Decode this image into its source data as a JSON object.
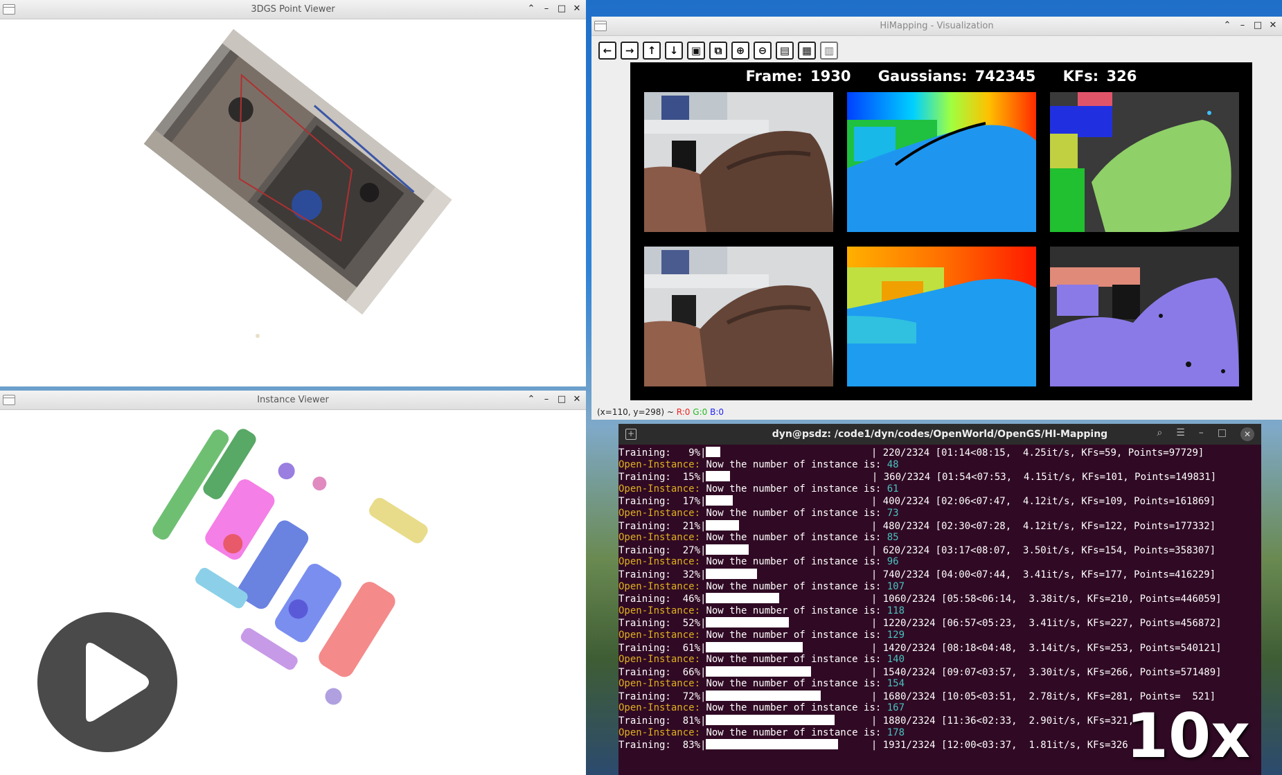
{
  "point_viewer": {
    "title": "3DGS Point Viewer"
  },
  "instance_viewer": {
    "title": "Instance Viewer"
  },
  "visualization": {
    "title": "HiMapping - Visualization",
    "toolbar": [
      "arrow-left-icon",
      "arrow-right-icon",
      "arrow-up-icon",
      "arrow-down-icon",
      "frame-icon",
      "export-icon",
      "zoom-in-icon",
      "zoom-out-icon",
      "save-icon",
      "clipboard-icon",
      "settings-icon"
    ],
    "stats": {
      "frame": "Frame: 1930",
      "gaussians": "Gaussians: 742345",
      "kfs": "KFs: 326"
    },
    "coord": {
      "prefix": "(x=110, y=298) ~ ",
      "r": "R:0",
      "g": "G:0",
      "b": "B:0"
    }
  },
  "terminal": {
    "title": "dyn@psdz: /code1/dyn/codes/OpenWorld/OpenGS/HI-Mapping",
    "oi_label": "Open-Instance:",
    "oi_text": " Now the number of instance is: ",
    "lines": [
      {
        "type": "train",
        "pct": "9%",
        "frac": 0.09,
        "text": "| 220/2324 [01:14<08:15,  4.25it/s, KFs=59, Points=97729]"
      },
      {
        "type": "oi",
        "n": "48"
      },
      {
        "type": "train",
        "pct": "15%",
        "frac": 0.15,
        "text": "| 360/2324 [01:54<07:53,  4.15it/s, KFs=101, Points=149831]"
      },
      {
        "type": "oi",
        "n": "61"
      },
      {
        "type": "train",
        "pct": "17%",
        "frac": 0.17,
        "text": "| 400/2324 [02:06<07:47,  4.12it/s, KFs=109, Points=161869]"
      },
      {
        "type": "oi",
        "n": "73"
      },
      {
        "type": "train",
        "pct": "21%",
        "frac": 0.21,
        "text": "| 480/2324 [02:30<07:28,  4.12it/s, KFs=122, Points=177332]"
      },
      {
        "type": "oi",
        "n": "85"
      },
      {
        "type": "train",
        "pct": "27%",
        "frac": 0.27,
        "text": "| 620/2324 [03:17<08:07,  3.50it/s, KFs=154, Points=358307]"
      },
      {
        "type": "oi",
        "n": "96"
      },
      {
        "type": "train",
        "pct": "32%",
        "frac": 0.32,
        "text": "| 740/2324 [04:00<07:44,  3.41it/s, KFs=177, Points=416229]"
      },
      {
        "type": "oi",
        "n": "107"
      },
      {
        "type": "train",
        "pct": "46%",
        "frac": 0.46,
        "text": "| 1060/2324 [05:58<06:14,  3.38it/s, KFs=210, Points=446059]"
      },
      {
        "type": "oi",
        "n": "118"
      },
      {
        "type": "train",
        "pct": "52%",
        "frac": 0.52,
        "text": "| 1220/2324 [06:57<05:23,  3.41it/s, KFs=227, Points=456872]"
      },
      {
        "type": "oi",
        "n": "129"
      },
      {
        "type": "train",
        "pct": "61%",
        "frac": 0.61,
        "text": "| 1420/2324 [08:18<04:48,  3.14it/s, KFs=253, Points=540121]"
      },
      {
        "type": "oi",
        "n": "140"
      },
      {
        "type": "train",
        "pct": "66%",
        "frac": 0.66,
        "text": "| 1540/2324 [09:07<03:57,  3.30it/s, KFs=266, Points=571489]"
      },
      {
        "type": "oi",
        "n": "154"
      },
      {
        "type": "train",
        "pct": "72%",
        "frac": 0.72,
        "text": "| 1680/2324 [10:05<03:51,  2.78it/s, KFs=281, Points=  521]"
      },
      {
        "type": "oi",
        "n": "167"
      },
      {
        "type": "train",
        "pct": "81%",
        "frac": 0.81,
        "text": "| 1880/2324 [11:36<02:33,  2.90it/s, KFs=321,"
      },
      {
        "type": "oi",
        "n": "178"
      },
      {
        "type": "train",
        "pct": "83%",
        "frac": 0.83,
        "text": "| 1931/2324 [12:00<03:37,  1.81it/s, KFs=326"
      }
    ]
  },
  "overlay": {
    "speed": "10x"
  }
}
